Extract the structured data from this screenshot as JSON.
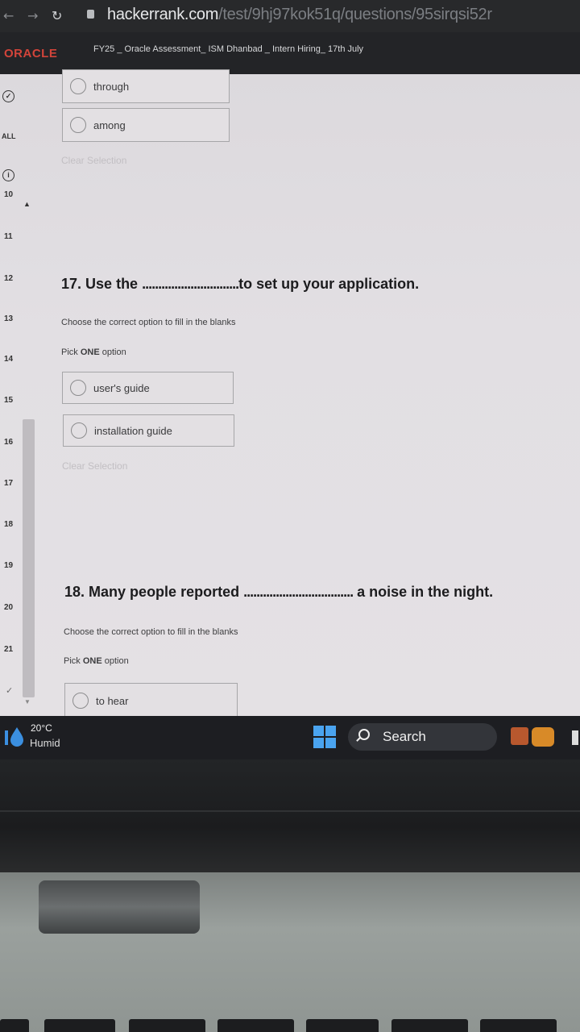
{
  "browser": {
    "url_main": "hackerrank.com",
    "url_path": "/test/9hj97kok51q/questions/95sirqsi52r"
  },
  "header": {
    "logo": "ORACLE",
    "test_title": "FY25 _ Oracle Assessment_ ISM Dhanbad _ Intern Hiring_ 17th July"
  },
  "sidebar": {
    "all_label": "ALL",
    "numbers": [
      "10",
      "11",
      "12",
      "13",
      "14",
      "15",
      "16",
      "17",
      "18",
      "19",
      "20",
      "21"
    ]
  },
  "q16": {
    "options": [
      "through",
      "among"
    ],
    "clear_label": "Clear Selection"
  },
  "q17": {
    "number": "17.",
    "prefix": "Use the",
    "blank": "..............................",
    "suffix": "to set up your application.",
    "instruction": "Choose the correct option to fill in the blanks",
    "pick_prefix": "Pick",
    "pick_bold": "ONE",
    "pick_suffix": "option",
    "options": [
      "user's guide",
      "installation guide"
    ],
    "clear_label": "Clear Selection"
  },
  "q18": {
    "number": "18.",
    "prefix": "Many people reported",
    "blank": "..................................",
    "suffix": "a noise in the night.",
    "instruction": "Choose the correct option to fill in the blanks",
    "pick_prefix": "Pick",
    "pick_bold": "ONE",
    "pick_suffix": "option",
    "options": [
      "to hear"
    ]
  },
  "taskbar": {
    "temperature": "20°C",
    "weather": "Humid",
    "search_label": "Search"
  }
}
